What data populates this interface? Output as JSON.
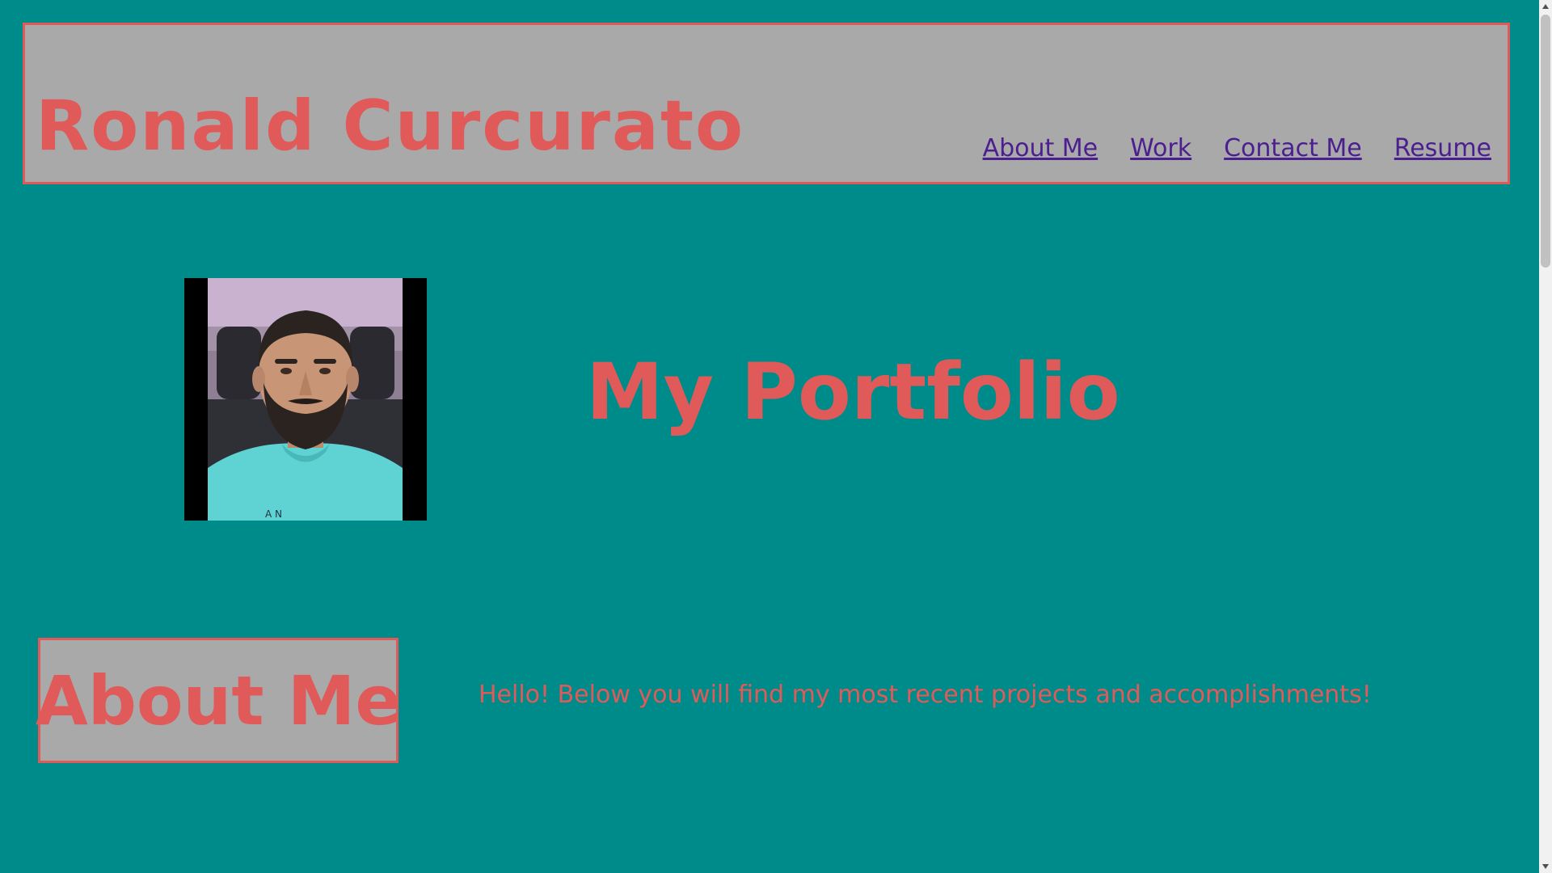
{
  "header": {
    "title": "Ronald Curcurato",
    "nav": [
      {
        "label": "About Me"
      },
      {
        "label": "Work"
      },
      {
        "label": "Contact Me"
      },
      {
        "label": "Resume"
      }
    ]
  },
  "hero": {
    "heading": "My Portfolio",
    "photo_icon": "profile-photo"
  },
  "about": {
    "title": "About Me",
    "intro": "Hello! Below you will find my most recent projects and accomplishments!"
  },
  "colors": {
    "background": "#008b8b",
    "accent": "#e05a5a",
    "panel": "#a9a9a9",
    "link": "#4b1f8f"
  }
}
